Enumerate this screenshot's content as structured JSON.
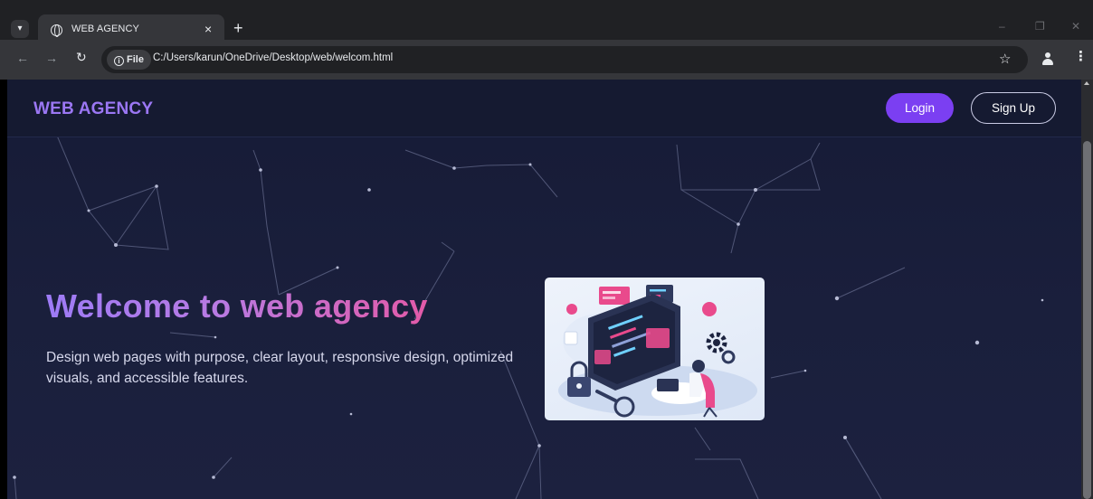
{
  "browser": {
    "tab_title": "WEB AGENCY",
    "new_tab": "+",
    "close_tab": "×",
    "site_info_chip": "File",
    "url": "C:/Users/karun/OneDrive/Desktop/web/welcom.html",
    "bookmark_star": "☆",
    "menu": "⋮",
    "back": "←",
    "forward": "→",
    "reload": "↻",
    "window_controls": {
      "minimize": "–",
      "restore": "❐",
      "close": "✕"
    }
  },
  "navbar": {
    "brand": "WEB AGENCY",
    "login_label": "Login",
    "signup_label": "Sign Up"
  },
  "hero": {
    "title": "Welcome to web agency",
    "description": "Design web pages with purpose, clear layout, responsive design, optimized visuals, and accessible features."
  },
  "illustration": {
    "icons": [
      "padlock-icon",
      "gear-icon",
      "magnifier-icon",
      "monitor-icon",
      "developer-person"
    ]
  },
  "colors": {
    "chrome_bg": "#202124",
    "toolbar_bg": "#35363a",
    "page_bg": "#1a1f3c",
    "navbar_bg": "#151a31",
    "brand": "#9b77f4",
    "login_button": "#7b3ff2",
    "title_gradient_start": "#9d7bf7",
    "title_gradient_end": "#e35aa8",
    "accent_pink": "#e94a8c"
  }
}
